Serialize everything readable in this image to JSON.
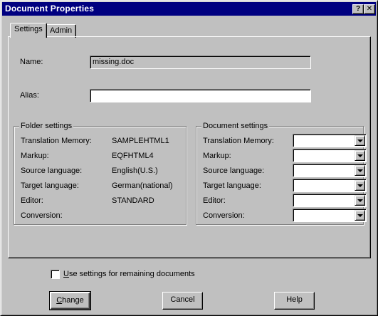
{
  "window": {
    "title": "Document Properties",
    "help_button": "?",
    "close_button": "✕"
  },
  "tabs": [
    {
      "label": "Settings",
      "active": true
    },
    {
      "label": "Admin",
      "active": false
    }
  ],
  "name": {
    "label": "Name:",
    "value": "missing.doc"
  },
  "alias": {
    "label": "Alias:",
    "value": ""
  },
  "folder_settings": {
    "title": "Folder settings",
    "rows": [
      {
        "label": "Translation Memory:",
        "value": "SAMPLEHTML1"
      },
      {
        "label": "Markup:",
        "value": "EQFHTML4"
      },
      {
        "label": "Source language:",
        "value": "English(U.S.)"
      },
      {
        "label": "Target language:",
        "value": "German(national)"
      },
      {
        "label": "Editor:",
        "value": "STANDARD"
      },
      {
        "label": "Conversion:",
        "value": ""
      }
    ]
  },
  "document_settings": {
    "title": "Document settings",
    "rows": [
      {
        "label": "Translation Memory:",
        "value": ""
      },
      {
        "label": "Markup:",
        "value": ""
      },
      {
        "label": "Source language:",
        "value": ""
      },
      {
        "label": "Target language:",
        "value": ""
      },
      {
        "label": "Editor:",
        "value": ""
      },
      {
        "label": "Conversion:",
        "value": ""
      }
    ]
  },
  "use_remaining": {
    "label_underlined": "U",
    "label_rest": "se settings for remaining documents",
    "checked": false
  },
  "buttons": {
    "change_underlined": "C",
    "change_rest": "hange",
    "cancel": "Cancel",
    "help": "Help"
  },
  "colors": {
    "titlebar": "#000080",
    "face": "#c0c0c0"
  }
}
